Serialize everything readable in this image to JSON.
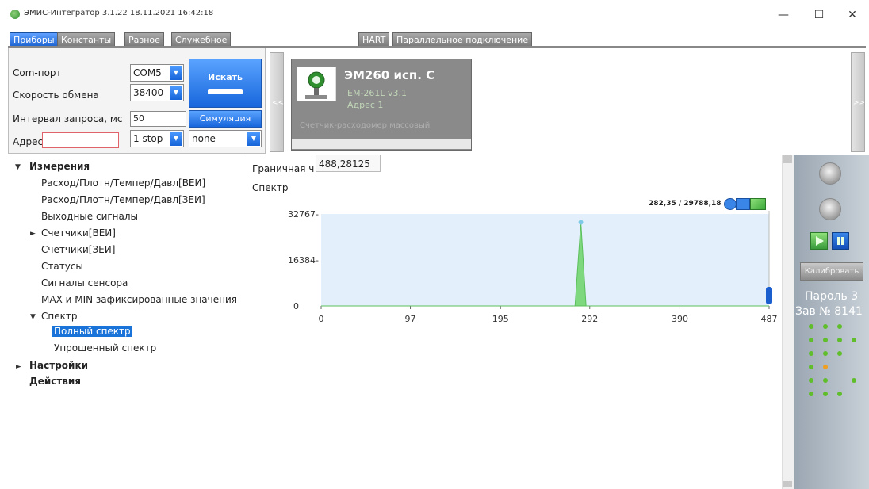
{
  "window": {
    "title": "ЭМИС-Интегратор 3.1.22 18.11.2021 16:42:18",
    "minimize": "—",
    "maximize": "☐",
    "close": "✕"
  },
  "tabs": {
    "left": [
      "Приборы",
      "Константы",
      "Разное",
      "Служебное"
    ],
    "right": [
      "HART",
      "Параллельное подключение"
    ],
    "active": "Приборы"
  },
  "connection": {
    "com_port_label": "Com-порт",
    "com_port_value": "COM5",
    "baud_label": "Скорость обмена",
    "baud_value": "38400",
    "interval_label": "Интервал запроса, мс",
    "interval_value": "50",
    "address_label": "Адрес",
    "address_value": "",
    "stop_bits": "1 stop",
    "parity": "none",
    "search_button": "Искать",
    "simulation_button": "Симуляция"
  },
  "device_card": {
    "name": "ЭМ260 исп. С",
    "model": "EM-261L v3.1",
    "address": "Адрес 1",
    "description": "Счетчик-расходомер массовый"
  },
  "tree": {
    "measurements": "Измерения",
    "items": [
      "Расход/Плотн/Темпер/Давл[ВЕИ]",
      "Расход/Плотн/Темпер/Давл[ЗЕИ]",
      "Выходные сигналы",
      "Счетчики[ВЕИ]",
      "Счетчики[ЗЕИ]",
      "Статусы",
      "Сигналы сенсора",
      "MAX и MIN зафиксированные значения",
      "Спектр"
    ],
    "spectrum_children": [
      "Полный спектр",
      "Упрощенный спектр"
    ],
    "settings": "Настройки",
    "actions": "Действия"
  },
  "spectrum": {
    "boundary_label": "Граничная ч",
    "boundary_value": "488,28125",
    "title": "Спектр",
    "readout": "282,35 / 29788,18"
  },
  "chart_data": {
    "type": "area",
    "x_ticks": [
      "0",
      "97",
      "195",
      "292",
      "390",
      "487"
    ],
    "y_ticks": [
      "32767",
      "16384",
      "0"
    ],
    "xlim": [
      0,
      487
    ],
    "ylim": [
      0,
      32767
    ],
    "series": [
      {
        "x": [
          0,
          276,
          282.35,
          288,
          487
        ],
        "y": [
          0,
          0,
          29788.18,
          0,
          0
        ]
      }
    ],
    "colors": {
      "fill": "#e3f0fb",
      "peak": "#7ed87e"
    }
  },
  "status_panel": {
    "calibrate": "Калибровать",
    "password": "Пароль 3",
    "serial": "Зав № 8141"
  }
}
